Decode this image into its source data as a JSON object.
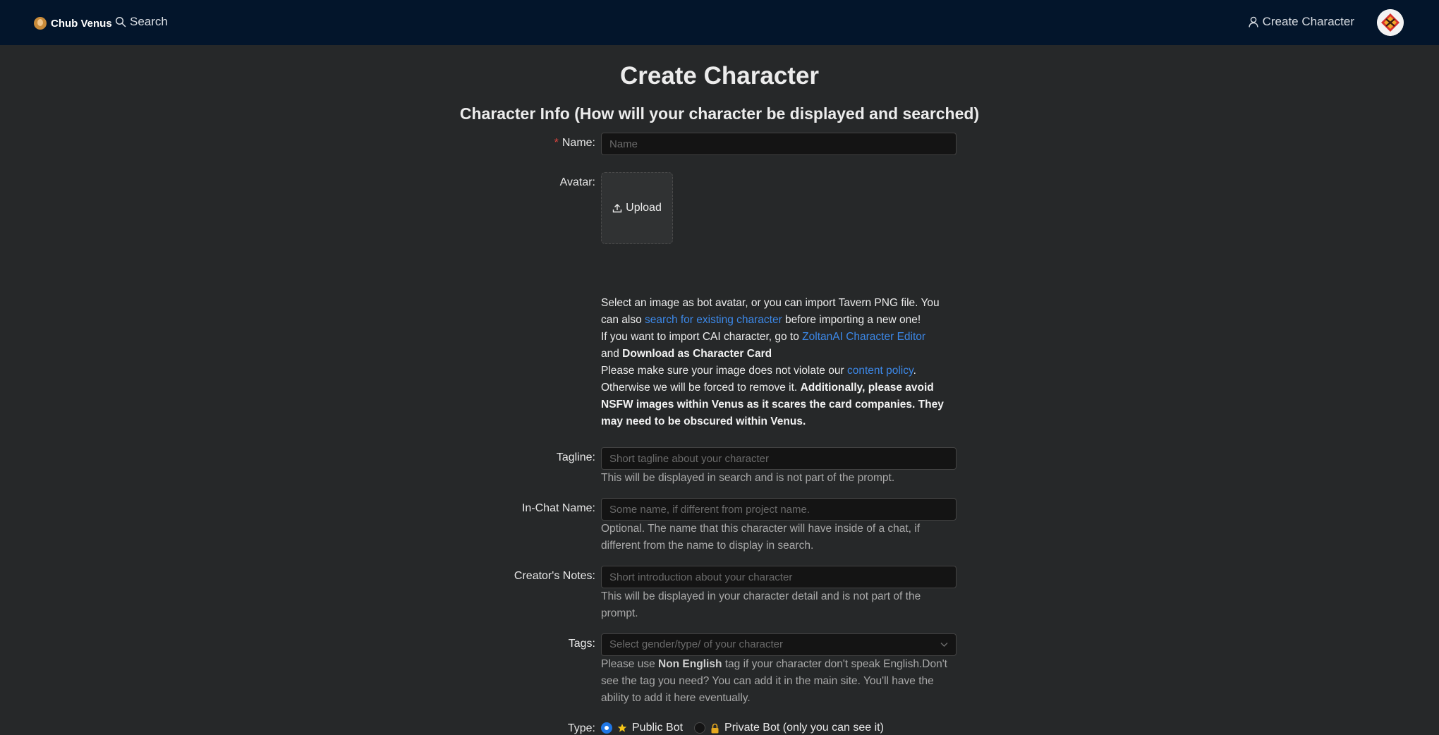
{
  "nav": {
    "brand": "Chub Venus",
    "search_label": "Search",
    "create_label": "Create Character"
  },
  "page": {
    "title": "Create Character",
    "section_title": "Character Info (How will your character be displayed and searched)"
  },
  "form": {
    "name": {
      "label": "Name:",
      "required_mark": "*",
      "placeholder": "Name",
      "value": ""
    },
    "avatar": {
      "label": "Avatar:",
      "upload_label": "Upload",
      "info": {
        "l1": "Select an image as bot avatar, or you can import Tavern PNG file. You can also ",
        "link1": "search for existing character",
        "l2": " before importing a new one!",
        "l3": "If you want to import CAI character, go to ",
        "link2": "ZoltanAI Character Editor",
        "l4": "and ",
        "b1": "Download as Character Card",
        "l5": "Please make sure your image does not violate our ",
        "link3": "content policy",
        "l6": ". Otherwise we will be forced to remove it. ",
        "b2": "Additionally, please avoid NSFW images within Venus as it scares the card companies. They may need to be obscured within Venus."
      }
    },
    "tagline": {
      "label": "Tagline:",
      "placeholder": "Short tagline about your character",
      "help": "This will be displayed in search and is not part of the prompt."
    },
    "in_chat_name": {
      "label": "In-Chat Name:",
      "placeholder": "Some name, if different from project name.",
      "help": "Optional. The name that this character will have inside of a chat, if different from the name to display in search."
    },
    "creators_notes": {
      "label": "Creator's Notes:",
      "placeholder": "Short introduction about your character",
      "help": "This will be displayed in your character detail and is not part of the prompt."
    },
    "tags": {
      "label": "Tags:",
      "placeholder": "Select gender/type/ of your character",
      "help_pre": "Please use ",
      "help_bold": "Non English",
      "help_post": " tag if your character don't speak English.Don't see the tag you need? You can add it in the main site. You'll have the ability to add it here eventually."
    },
    "type": {
      "label": "Type:",
      "options": [
        {
          "label": "Public Bot",
          "icon": "star-icon",
          "selected": true
        },
        {
          "label": "Private Bot (only you can see it)",
          "icon": "lock-icon",
          "selected": false
        }
      ]
    }
  },
  "colors": {
    "background": "#262829",
    "topbar": "#03152b",
    "link": "#3c88e8",
    "required": "#e0463f",
    "radio_selected": "#1f77e6",
    "star": "#f5c518",
    "lock": "#e5a81f"
  }
}
